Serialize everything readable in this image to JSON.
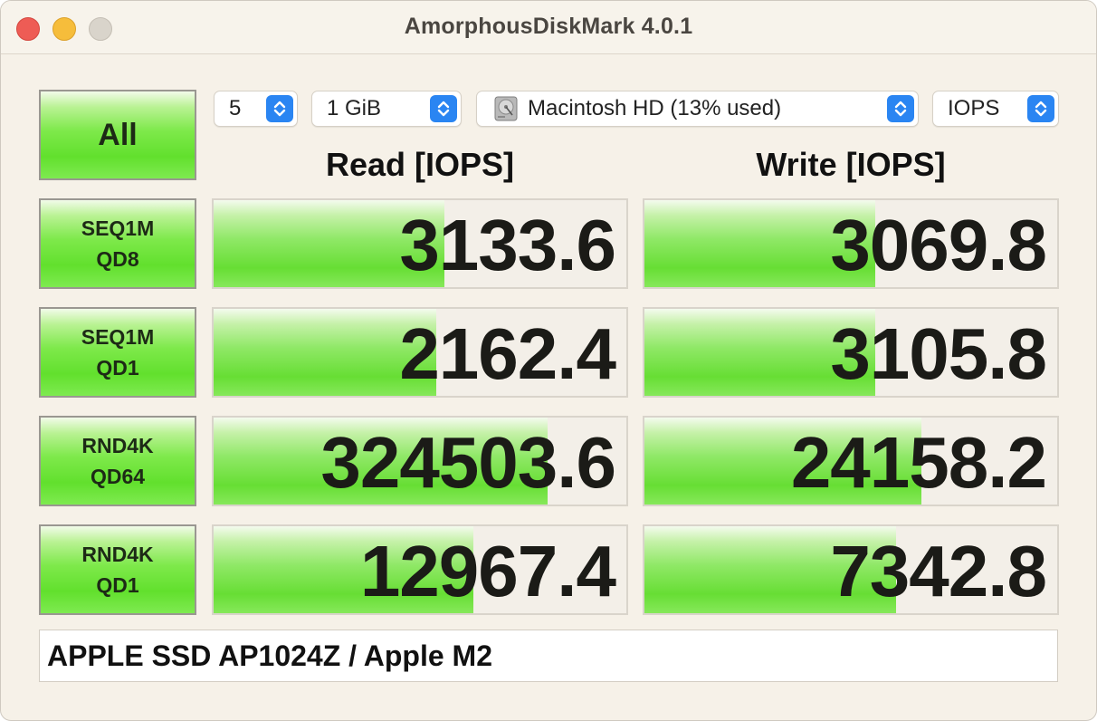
{
  "window": {
    "title": "AmorphousDiskMark 4.0.1"
  },
  "controls": {
    "all_label": "All",
    "count": "5",
    "size": "1 GiB",
    "target": "Macintosh HD (13% used)",
    "unit": "IOPS"
  },
  "headers": {
    "read": "Read [IOPS]",
    "write": "Write [IOPS]"
  },
  "tests": [
    {
      "line1": "SEQ1M",
      "line2": "QD8",
      "read": "3133.6",
      "write": "3069.8",
      "read_fill_pct": 56,
      "write_fill_pct": 56
    },
    {
      "line1": "SEQ1M",
      "line2": "QD1",
      "read": "2162.4",
      "write": "3105.8",
      "read_fill_pct": 54,
      "write_fill_pct": 56
    },
    {
      "line1": "RND4K",
      "line2": "QD64",
      "read": "324503.6",
      "write": "24158.2",
      "read_fill_pct": 81,
      "write_fill_pct": 67
    },
    {
      "line1": "RND4K",
      "line2": "QD1",
      "read": "12967.4",
      "write": "7342.8",
      "read_fill_pct": 63,
      "write_fill_pct": 61
    }
  ],
  "footer": {
    "device": "APPLE SSD AP1024Z / Apple M2"
  },
  "colors": {
    "accent": "#2a85f2",
    "bar_green": "#67de34",
    "close": "#ee5c55",
    "minimize": "#f6bd3b"
  },
  "icons": {
    "stepper": "up-down-chevron-icon",
    "disk": "hard-disk-icon"
  }
}
